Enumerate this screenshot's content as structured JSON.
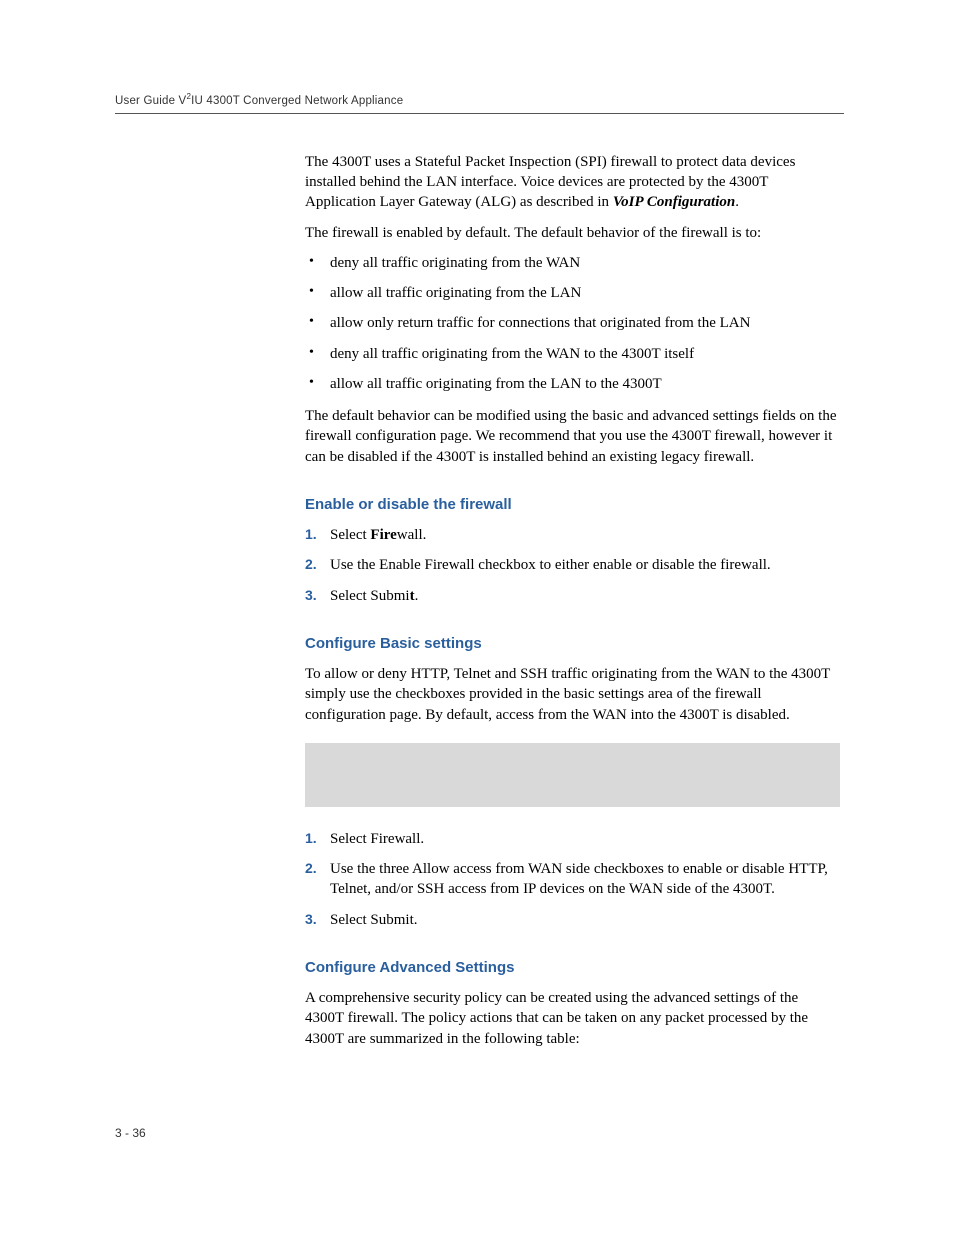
{
  "header": {
    "prefix": "User Guide V",
    "sup": "2",
    "suffix": "IU 4300T Converged Network Appliance"
  },
  "intro": {
    "p1a": "The 4300T uses a Stateful Packet Inspection (SPI) firewall to protect data devices installed behind the LAN interface.  Voice devices are protected by the 4300T Application Layer Gateway (ALG) as described in ",
    "p1b": "VoIP Configuration",
    "p1c": ".",
    "p2": "The firewall is enabled by default.  The default behavior of the firewall is to:",
    "bullets": [
      "deny all traffic originating from the WAN",
      "allow all traffic originating from the LAN",
      "allow only return traffic for connections that originated from the LAN",
      "deny all traffic originating from the WAN to the 4300T itself",
      "allow all traffic originating from the LAN to the 4300T"
    ],
    "p3": "The default behavior can be modified using the basic and advanced settings fields on the firewall configuration page.  We recommend that you use the 4300T firewall, however it can be disabled if the 4300T is installed behind an existing legacy firewall."
  },
  "section1": {
    "heading": "Enable or disable the firewall",
    "steps": [
      {
        "num": "1.",
        "pre": "Select ",
        "bold": "Fire",
        "post": "wall."
      },
      {
        "num": "2.",
        "text": "Use the Enable Firewall checkbox to either enable or disable the firewall."
      },
      {
        "num": "3.",
        "pre": "Select Submi",
        "bold": "t",
        "post": "."
      }
    ]
  },
  "section2": {
    "heading": "Configure Basic settings",
    "intro": "To allow or deny HTTP, Telnet and SSH traffic originating from the WAN to the 4300T simply use the checkboxes provided in the basic settings area of the firewall configuration page.  By default, access from the WAN into the 4300T is disabled.",
    "steps": [
      {
        "num": "1.",
        "text": "Select Firewall."
      },
      {
        "num": "2.",
        "text": "Use the three Allow access from WAN side checkboxes to enable or disable HTTP, Telnet, and/or SSH access from IP devices on the WAN side of the 4300T."
      },
      {
        "num": "3.",
        "text": "Select Submit."
      }
    ]
  },
  "section3": {
    "heading": "Configure Advanced Settings",
    "intro": "A comprehensive security policy can be created using the advanced settings of the 4300T firewall.  The policy actions that can be taken on any packet processed by the 4300T are summarized in the following table:"
  },
  "footer": "3 - 36"
}
